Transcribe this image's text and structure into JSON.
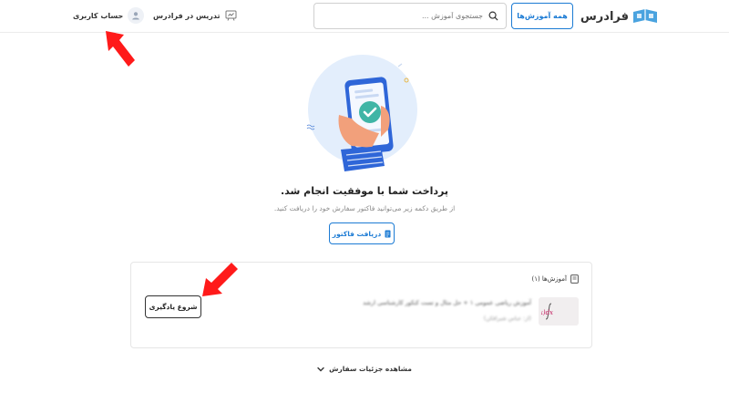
{
  "header": {
    "logo_text": "فرادرس",
    "all_courses_label": "همه آموزش‌ها",
    "search_placeholder": "جستجوی آموزش ...",
    "teach_label": "تدریس در فرادرس",
    "account_label": "حساب کاربری"
  },
  "success": {
    "title": "پرداخت شما با موفقیت انجام شد.",
    "subtitle": "از طریق دکمه زیر می‌توانید فاکتور سفارش خود را دریافت کنید.",
    "invoice_button": "دریافت فاکتور"
  },
  "courses_card": {
    "heading": "آموزش‌ها (۱)",
    "course": {
      "title": "آموزش ریاضی عمومی ۱ + حل مثال و تست کنکور کارشناسی ارشد",
      "teacher": "(از: عباس شیرافکن)",
      "thumb_text": "f(x)dx"
    },
    "start_button": "شروع یادگیری"
  },
  "details_link": "مشاهده جزئیات سفارش",
  "colors": {
    "brand_blue": "#1c7bd4",
    "arrow_red": "#ff1a1a",
    "illustration_circle": "#e3eefc"
  },
  "icons": {
    "search": "search-icon",
    "teach": "teach-board-icon",
    "avatar": "user-icon",
    "invoice": "document-icon",
    "book": "book-icon",
    "chevron": "chevron-down-icon"
  }
}
